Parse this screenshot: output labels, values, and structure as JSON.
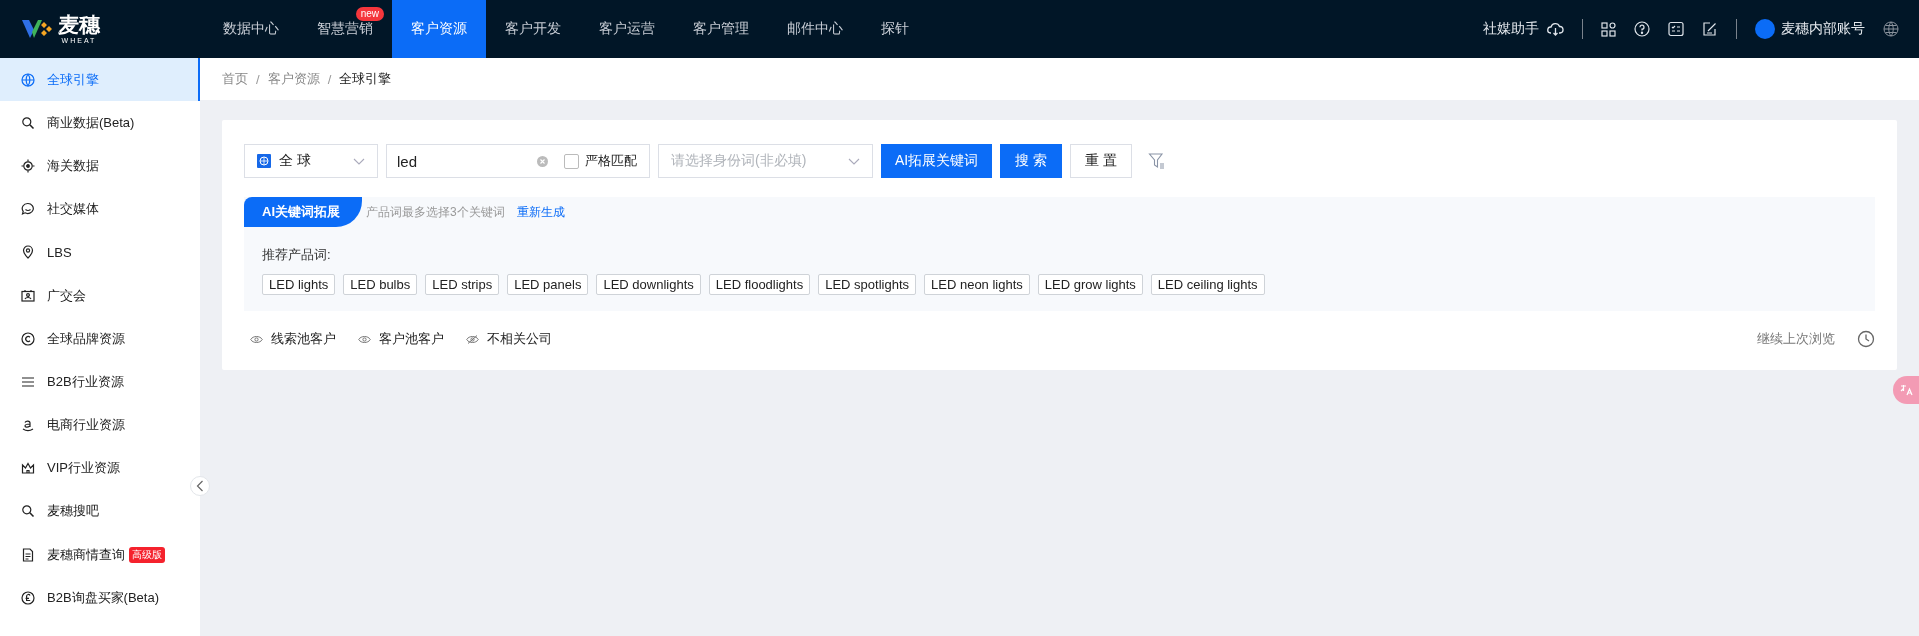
{
  "header": {
    "logo_text": "麦穗",
    "logo_subtext": "WHEAT",
    "nav": [
      {
        "label": "数据中心",
        "selected": false
      },
      {
        "label": "智慧营销",
        "selected": false,
        "badge": "new"
      },
      {
        "label": "客户资源",
        "selected": true
      },
      {
        "label": "客户开发",
        "selected": false
      },
      {
        "label": "客户运营",
        "selected": false
      },
      {
        "label": "客户管理",
        "selected": false
      },
      {
        "label": "邮件中心",
        "selected": false
      },
      {
        "label": "探针",
        "selected": false
      }
    ],
    "assistant": "社媒助手",
    "account": "麦穗内部账号"
  },
  "sidebar": {
    "items": [
      {
        "label": "全球引擎",
        "selected": true
      },
      {
        "label": "商业数据(Beta)",
        "selected": false
      },
      {
        "label": "海关数据",
        "selected": false
      },
      {
        "label": "社交媒体",
        "selected": false
      },
      {
        "label": "LBS",
        "selected": false
      },
      {
        "label": "广交会",
        "selected": false
      },
      {
        "label": "全球品牌资源",
        "selected": false
      },
      {
        "label": "B2B行业资源",
        "selected": false
      },
      {
        "label": "电商行业资源",
        "selected": false
      },
      {
        "label": "VIP行业资源",
        "selected": false
      },
      {
        "label": "麦穗搜吧",
        "selected": false
      },
      {
        "label": "麦穗商情查询",
        "selected": false,
        "badge": "高级版"
      },
      {
        "label": "B2B询盘买家(Beta)",
        "selected": false
      }
    ]
  },
  "breadcrumb": [
    "首页",
    "客户资源",
    "全球引擎"
  ],
  "breadcrumb_separator": "/",
  "search": {
    "region": "全 球",
    "keyword": "led",
    "strict_match": {
      "label": "严格匹配",
      "checked": false
    },
    "identity_placeholder": "请选择身份词(非必填)",
    "ai_button": "AI拓展关键词",
    "search_button": "搜 索",
    "reset_button": "重 置"
  },
  "ai_panel": {
    "tab": "AI关键词拓展",
    "hint": "产品词最多选择3个关键词",
    "regenerate": "重新生成",
    "label": "推荐产品词:",
    "keywords": [
      "LED lights",
      "LED bulbs",
      "LED strips",
      "LED panels",
      "LED downlights",
      "LED floodlights",
      "LED spotlights",
      "LED neon lights",
      "LED grow lights",
      "LED ceiling lights"
    ]
  },
  "filters": [
    {
      "label": "线索池客户",
      "kind": "eye"
    },
    {
      "label": "客户池客户",
      "kind": "eye"
    },
    {
      "label": "不相关公司",
      "kind": "eye-off"
    }
  ],
  "continue_label": "继续上次浏览"
}
